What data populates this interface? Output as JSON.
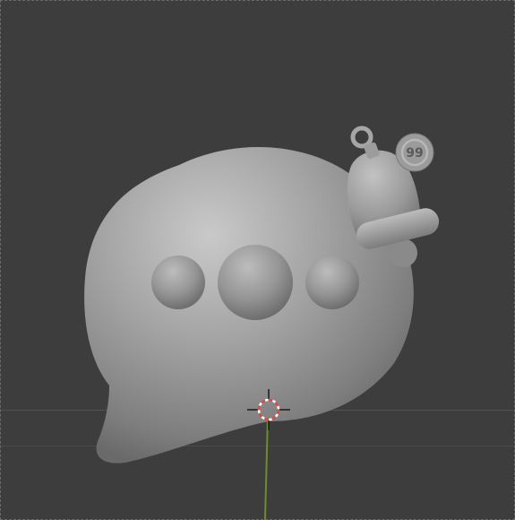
{
  "viewport": {
    "background_color": "#3d3d3d",
    "x_axis_color": "#7a4a4a",
    "y_axis_color": "#6f8b2e",
    "model_color": "#9a9a9a"
  },
  "model": {
    "badge_text": "99"
  },
  "icons": {
    "cursor": "3d-cursor-icon"
  }
}
